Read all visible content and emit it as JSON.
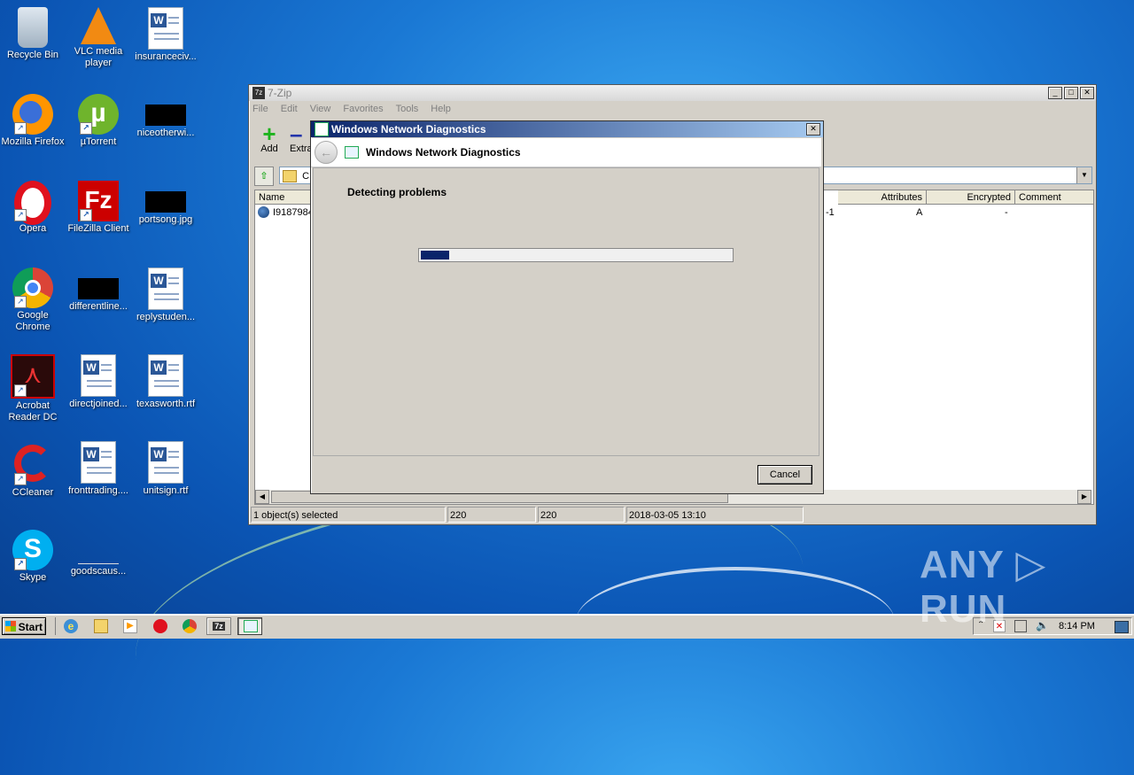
{
  "desktop": {
    "icons": [
      {
        "label": "Recycle Bin",
        "icon": "recycle-bin-icon"
      },
      {
        "label": "VLC media player",
        "icon": "vlc-icon"
      },
      {
        "label": "insuranceciv...",
        "icon": "word-doc-icon"
      },
      {
        "label": "Mozilla Firefox",
        "icon": "firefox-icon"
      },
      {
        "label": "µTorrent",
        "icon": "utorrent-icon"
      },
      {
        "label": "niceotherwi...",
        "icon": "image-file-icon"
      },
      {
        "label": "Opera",
        "icon": "opera-icon"
      },
      {
        "label": "FileZilla Client",
        "icon": "filezilla-icon"
      },
      {
        "label": "portsong.jpg",
        "icon": "image-file-icon"
      },
      {
        "label": "Google Chrome",
        "icon": "chrome-icon"
      },
      {
        "label": "differentline...",
        "icon": "image-file-icon"
      },
      {
        "label": "replystuden...",
        "icon": "word-doc-icon"
      },
      {
        "label": "Acrobat Reader DC",
        "icon": "acrobat-icon"
      },
      {
        "label": "directjoined...",
        "icon": "word-doc-icon"
      },
      {
        "label": "texasworth.rtf",
        "icon": "word-doc-icon"
      },
      {
        "label": "CCleaner",
        "icon": "ccleaner-icon"
      },
      {
        "label": "fronttrading....",
        "icon": "word-doc-icon"
      },
      {
        "label": "unitsign.rtf",
        "icon": "word-doc-icon"
      },
      {
        "label": "Skype",
        "icon": "skype-icon"
      },
      {
        "label": "goodscaus...",
        "icon": "blank-file-icon"
      }
    ]
  },
  "zip_window": {
    "title": "7-Zip",
    "app_icon_text": "7z",
    "menu": [
      "File",
      "Edit",
      "View",
      "Favorites",
      "Tools",
      "Help"
    ],
    "toolbar": {
      "add_label": "Add",
      "extract_label": "Extra"
    },
    "address": "C:\\",
    "columns": {
      "name": "Name",
      "attributes": "Attributes",
      "encrypted": "Encrypted",
      "comment": "Comment"
    },
    "rows": [
      {
        "name": "I9187984",
        "partial": "-1",
        "attributes": "A",
        "encrypted": "-"
      }
    ],
    "status": {
      "selected": "1 object(s) selected",
      "size": "220",
      "packed": "220",
      "modified": "2018-03-05 13:10"
    }
  },
  "diag_window": {
    "title": "Windows Network Diagnostics",
    "header": "Windows Network Diagnostics",
    "message": "Detecting problems",
    "progress": 0.09,
    "cancel_label": "Cancel"
  },
  "taskbar": {
    "start_label": "Start",
    "clock": "8:14 PM",
    "zip_icon_text": "7z"
  },
  "watermark": "ANY ▷ RUN",
  "colors": {
    "title_active_start": "#0a246a",
    "title_active_end": "#a6caf0",
    "progress_fill": "#0a246a"
  }
}
